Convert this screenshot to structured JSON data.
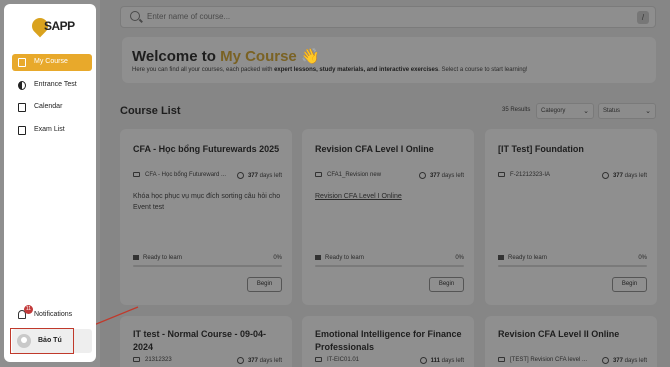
{
  "search": {
    "placeholder": "Enter name of course...",
    "shortcut": "/"
  },
  "welcome": {
    "title_prefix": "Welcome to ",
    "title_highlight": "My Course",
    "title_emoji": "👋",
    "desc_pre": "Here you can find all your courses, each packed with ",
    "desc_bold": "expert lessons, study materials, and interactive exercises",
    "desc_post": ". Select a course to start learning!"
  },
  "course_list": {
    "title": "Course List",
    "results": "35 Results",
    "category": "Category",
    "status": "Status"
  },
  "cards": [
    {
      "title": "CFA - Học bổng Futurewards 2025",
      "code": "CFA - Học bổng Futureward ...",
      "days_num": "377",
      "days_text": " days left",
      "desc": "Khóa học phục vụ mục đích sorting câu hỏi cho Event test",
      "ready": "Ready to learn",
      "pct": "0%",
      "begin": "Begin"
    },
    {
      "title": "Revision CFA Level I Online",
      "code": "CFA1_Revision new",
      "days_num": "377",
      "days_text": " days left",
      "desc": "Revision CFA Level I Online",
      "ready": "Ready to learn",
      "pct": "0%",
      "begin": "Begin"
    },
    {
      "title": "[IT Test] Foundation",
      "code": "F-21212323-IA",
      "days_num": "377",
      "days_text": " days left",
      "desc": "",
      "ready": "Ready to learn",
      "pct": "0%",
      "begin": "Begin"
    },
    {
      "title": "IT test - Normal Course - 09-04-2024",
      "code": "21312323",
      "days_num": "377",
      "days_text": " days left"
    },
    {
      "title": "Emotional Intelligence for Finance Professionals",
      "code": "IT-EIC01.01",
      "days_num": "111",
      "days_text": " days left"
    },
    {
      "title": "Revision CFA Level II Online",
      "code": "[TEST] Revision CFA level ...",
      "days_num": "377",
      "days_text": " days left"
    }
  ],
  "sidebar": {
    "logo": "SAPP",
    "items": [
      {
        "label": "My Course"
      },
      {
        "label": "Entrance Test"
      },
      {
        "label": "Calendar"
      },
      {
        "label": "Exam List"
      }
    ],
    "notifications": {
      "label": "Notifications",
      "count": "11"
    },
    "user": {
      "name": "Bảo Tú"
    }
  },
  "colors": {
    "accent": "#e8a92b",
    "highlight": "#c0392b"
  }
}
